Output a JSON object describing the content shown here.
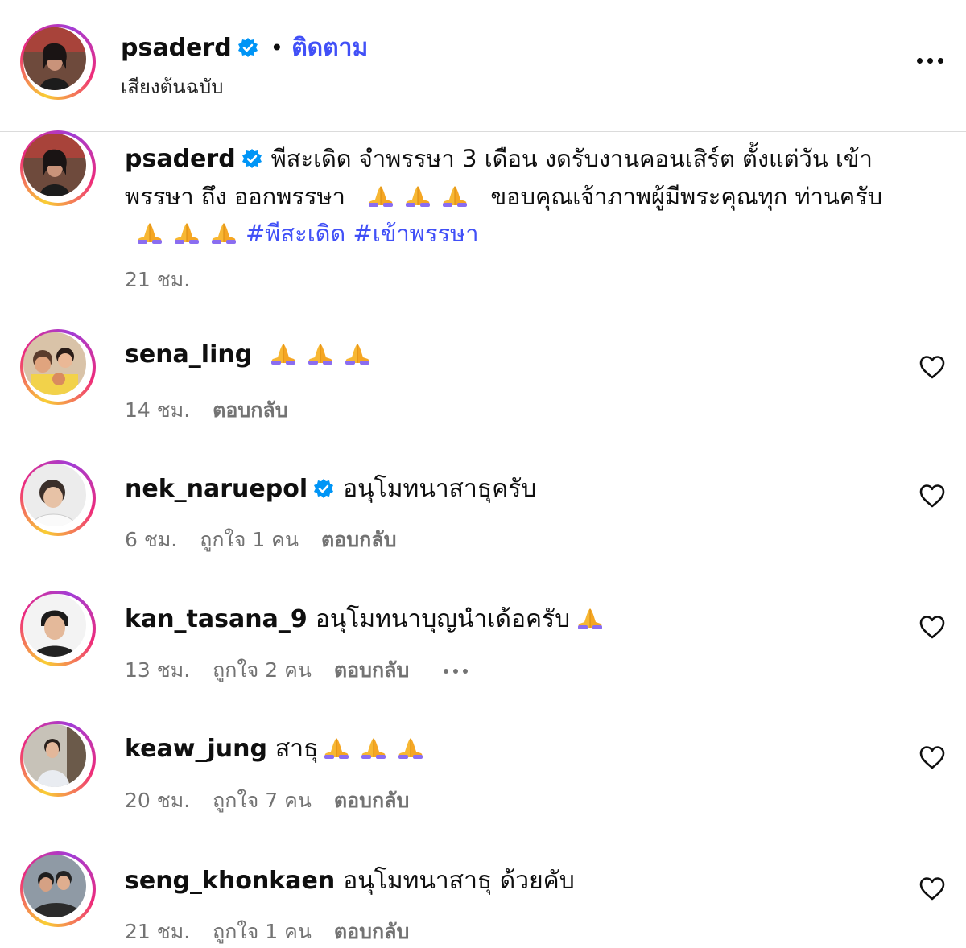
{
  "header": {
    "username": "psaderd",
    "separator": "•",
    "follow_label": "ติดตาม",
    "audio_label": "เสียงต้นฉบับ"
  },
  "caption": {
    "username": "psaderd",
    "text_part1": "พีสะเดิด จำพรรษา 3 เดือน งดรับงานคอนเสิร์ต ตั้งแต่วัน เข้าพรรษา ถึง ออกพรรษา",
    "text_part2": "ขอบคุณเจ้าภาพผู้มีพระคุณทุก ท่านครับ",
    "hashtags": "#พีสะเดิด #เข้าพรรษา",
    "time": "21 ชม."
  },
  "comments": [
    {
      "username": "sena_ling",
      "text": "",
      "time": "14 ชม.",
      "likes": "",
      "reply": "ตอบกลับ"
    },
    {
      "username": "nek_naruepol",
      "text": "อนุโมทนาสาธุครับ",
      "time": "6 ชม.",
      "likes": "ถูกใจ 1 คน",
      "reply": "ตอบกลับ"
    },
    {
      "username": "kan_tasana_9",
      "text": "อนุโมทนาบุญนำเด้อครับ",
      "time": "13 ชม.",
      "likes": "ถูกใจ 2 คน",
      "reply": "ตอบกลับ"
    },
    {
      "username": "keaw_jung",
      "text": "สาธุ",
      "time": "20 ชม.",
      "likes": "ถูกใจ 7 คน",
      "reply": "ตอบกลับ"
    },
    {
      "username": "seng_khonkaen",
      "text": "อนุโมทนาสาธุ ด้วยคับ",
      "time": "21 ชม.",
      "likes": "ถูกใจ 1 คน",
      "reply": "ตอบกลับ"
    }
  ],
  "icons": {
    "verified": "verified-badge-icon",
    "more": "more-options-icon",
    "heart": "heart-icon",
    "pray": "folded-hands-emoji"
  },
  "colors": {
    "link": "#4150f7",
    "verified": "#0095f6",
    "meta_text": "#737373"
  }
}
